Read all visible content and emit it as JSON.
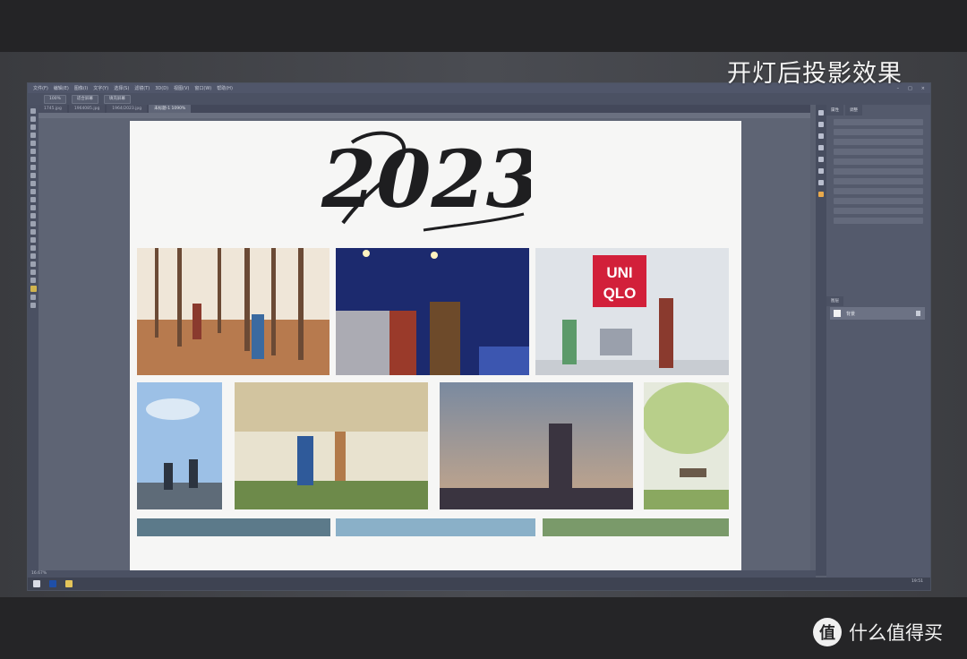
{
  "caption": "开灯后投影效果",
  "watermark": {
    "logo_glyph": "值",
    "text": "什么值得买"
  },
  "photoshop": {
    "menu_items": [
      "文件(F)",
      "编辑(E)",
      "图像(I)",
      "文字(Y)",
      "选择(S)",
      "滤镜(T)",
      "3D(D)",
      "视图(V)",
      "窗口(W)",
      "帮助(H)"
    ],
    "options": [
      "100%",
      "适合屏幕",
      "填充屏幕"
    ],
    "tabs": [
      "1745.jpg",
      "1964085.jpg",
      "1964/2023.jpg",
      "未标题-1 1090%"
    ],
    "panel_tabs": [
      "属性",
      "调整"
    ],
    "layers_tab": "图层",
    "layer_name": "背景",
    "status_text": "16.67%",
    "clock": "19:51"
  },
  "document": {
    "title_art_text": "2023",
    "photos": [
      {
        "name": "photo-autumn-forest",
        "colors": [
          "#d9b38c",
          "#8a5a3a",
          "#efe6d8"
        ]
      },
      {
        "name": "photo-night-sparklers",
        "colors": [
          "#1c2a6e",
          "#3c56b0",
          "#e8e2d0"
        ]
      },
      {
        "name": "photo-uniqlo-wall",
        "colors": [
          "#dfe3e8",
          "#c8ccd2",
          "#d2203a"
        ]
      },
      {
        "name": "photo-bicycles",
        "colors": [
          "#9cc0e6",
          "#dce9f5",
          "#5e6b78"
        ]
      },
      {
        "name": "photo-running-park",
        "colors": [
          "#c9b88a",
          "#6d8a4a",
          "#e8e2cf"
        ]
      },
      {
        "name": "photo-silhouette-sky",
        "colors": [
          "#7a8aa0",
          "#c7a78a",
          "#3a3440"
        ]
      },
      {
        "name": "photo-bench-trees",
        "colors": [
          "#b8cf8a",
          "#8aa860",
          "#e5e9dc"
        ]
      }
    ],
    "uniqlo_logo": [
      "UNI",
      "QLO"
    ]
  }
}
